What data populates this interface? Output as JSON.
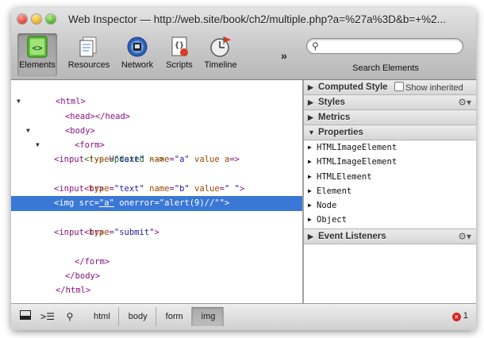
{
  "window": {
    "title": "Web Inspector — http://web.site/book/ch2/multiple.php?a=%27a%3D&b=+%2..."
  },
  "toolbar": {
    "items": [
      {
        "label": "Elements",
        "icon": "elements-icon",
        "selected": true
      },
      {
        "label": "Resources",
        "icon": "resources-icon"
      },
      {
        "label": "Network",
        "icon": "network-icon"
      },
      {
        "label": "Scripts",
        "icon": "scripts-icon"
      },
      {
        "label": "Timeline",
        "icon": "timeline-icon"
      }
    ],
    "more": "»",
    "search": {
      "placeholder": "",
      "value": "",
      "label": "Search Elements"
    }
  },
  "dom": {
    "l1": {
      "tag": "<html>"
    },
    "l2": {
      "tag": "<head></head>"
    },
    "l3": {
      "tag": "<body>"
    },
    "l4": {
      "tag": "<form>"
    },
    "l5": {
      "comment": "<!-- Updated -->"
    },
    "l6": {
      "t1": "<input ",
      "a1": "type",
      "eq1": "=",
      "v1": "\"text\"",
      "a2": " name",
      "eq2": "=",
      "v2": "\"a\"",
      "a3": " value a",
      "eq3": "=",
      "t2": ">"
    },
    "l7": {
      "tag": "<br>"
    },
    "l8": {
      "t1": "<input ",
      "a1": "type",
      "eq1": "=",
      "v1": "\"text\"",
      "a2": " name",
      "eq2": "=",
      "v2": "\"b\"",
      "a3": " value",
      "eq3": "=",
      "v3": "\" \"",
      "t2": ">"
    },
    "l9": {
      "t1": "<img ",
      "a1": "src",
      "eq1": "=",
      "v1": "\"a\"",
      "a2": " onerror",
      "eq2": "=",
      "v2": "\"alert(9)//\"\"",
      "t2": ">"
    },
    "l10": {
      "tag": "<br>"
    },
    "l11": {
      "t1": "<input ",
      "a1": "type",
      "eq1": "=",
      "v1": "\"submit\"",
      "t2": ">"
    },
    "l12": {
      "tag": "</form>"
    },
    "l13": {
      "tag": "</body>"
    },
    "l14": {
      "tag": "</html>"
    }
  },
  "sidebar": {
    "computed": {
      "label": "Computed Style",
      "checkbox": "Show inherited"
    },
    "styles": "Styles",
    "metrics": "Metrics",
    "properties": {
      "label": "Properties",
      "items": [
        "HTMLImageElement",
        "HTMLImageElement",
        "HTMLElement",
        "Element",
        "Node",
        "Object"
      ]
    },
    "listeners": "Event Listeners"
  },
  "statusbar": {
    "breadcrumbs": [
      "html",
      "body",
      "form",
      "img"
    ],
    "error_count": "1"
  },
  "colors": {
    "selection": "#3b78d6",
    "tag": "#881280",
    "attribute": "#994500",
    "value": "#1a1aa6",
    "comment": "#236e25",
    "error": "#d22222"
  }
}
